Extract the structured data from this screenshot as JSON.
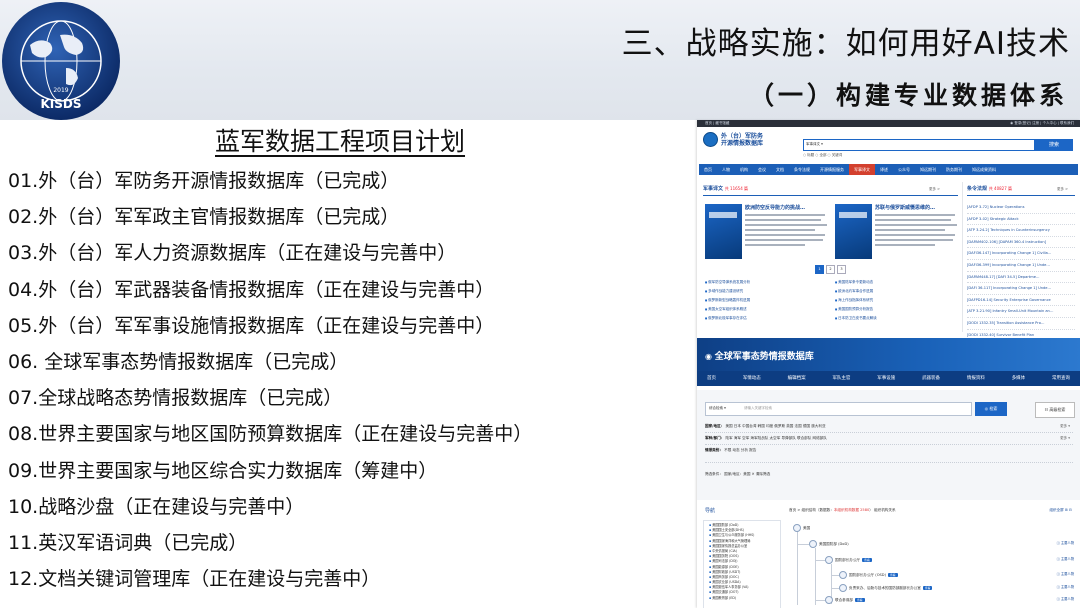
{
  "logo": {
    "text": "知远战略与防务研究所",
    "abbr": "KISDS",
    "year": "2019"
  },
  "header": {
    "title": "三、战略实施：如何用好AI技术",
    "subtitle": "（一）构建专业数据体系"
  },
  "plan": {
    "title": "蓝军数据工程项目计划",
    "items": [
      "01.外（台）军防务开源情报数据库（已完成）",
      "02.外（台）军军政主官情报数据库（已完成）",
      "03.外（台）军人力资源数据库（正在建设与完善中）",
      "04.外（台）军武器装备情报数据库（正在建设与完善中）",
      "05.外（台）军军事设施情报数据库（正在建设与完善中）",
      "06. 全球军事态势情报数据库（已完成）",
      "07.全球战略态势情报数据库（已完成）",
      "08.世界主要国家与地区国防预算数据库（正在建设与完善中）",
      "09.世界主要国家与地区综合实力数据库（筹建中）",
      "10.战略沙盘（正在建设与完善中）",
      "11.英汉军语词典（已完成）",
      "12.文档关键词管理库（正在建设与完善中）"
    ]
  },
  "site1": {
    "topbar_left": "首页  |  藏书馆藏",
    "topbar_right": "◉ 登录(登记) 注册  | 个人中心 | 联系我们",
    "brand": "外（台）军防务\n开源情报数据库",
    "search_select": "军事译文 ▾",
    "search_button": "搜索",
    "radios": "○ 标题  ○ 全部  ○ 关键词",
    "nav": [
      "首页",
      "人物",
      "机构",
      "会议",
      "文档",
      "条令法规",
      "开源情报服务",
      "军事译文",
      "译述",
      "公众号",
      "知远期刊",
      "防务期刊",
      "知远成果资料"
    ],
    "nav_active": "军事译文",
    "col1_title": "军事译文",
    "col1_count": "共 11654 篇",
    "col2_title": "条令法规",
    "col2_count": "共 40827 篇",
    "more": "更多 >",
    "card1_title": "欧洲防空反导能力的挑战…",
    "card2_title": "苏联与俄罗斯威慑思维的…",
    "pages": [
      "1",
      "2",
      "3"
    ],
    "right_list": [
      "[AFDP 3-72] Nuclear Operations",
      "[AFDP 3-02] Strategic Attack",
      "[ATP 3-24.2] Techniques in Counterinsurgency",
      "[DAPAM402-106] [DAPAM 360-4 Instruction]",
      "[DAFI36-147] Incorporating Change 1] Civilia…",
      "[DAFI36-399] Incorporating Change 1] Unde…",
      "[DAPAM448-17] [DAFI 34-5] Departme…",
      "[DAFI 36-117] Incorporating Change 1] Unde…",
      "[DAFPD16-14] Security Enterprise Governance",
      "[ATP 3-21.90] Infantry Small-Unit Mountain an…",
      "[DODI 1332.35] Transition Assistance Pro…",
      "[DODI 1332.40] Survivor Benefit Plan"
    ],
    "bottom_list_a": [
      "俄军防空导弹系统发展分析",
      "多域作战能力建设研究",
      "俄罗斯新型战略轰炸机进展",
      "美国太空军组织体系概述",
      "俄罗斯北极军事存在评估"
    ],
    "bottom_list_b": [
      "美国陆军条令更新动态",
      "欧洲北约军事合作进展",
      "海上作战指挥体系研究",
      "美国国防预算分析报告",
      "日本防卫白皮书要点解读"
    ]
  },
  "site2": {
    "title": "全球军事态势情报数据库",
    "nav": [
      "首页",
      "军情动态",
      "编辑档案",
      "军队主官",
      "军事设施",
      "武器装备",
      "情报资料",
      "多媒体",
      "常用查询"
    ],
    "search_select": "综合检索 ▾",
    "search_placeholder": "请输入关键字检索",
    "search_button": "◎ 检索",
    "adv_button": "☷ 高级检索",
    "filter1_label": "国家/地区：",
    "filter1_values": "美国   日本   中国台湾   韩国   印度   俄罗斯   英国   法国   德国   澳大利亚",
    "filter2_label": "军种/部门：",
    "filter2_values": "陆军   海军   空军   海军陆战队   太空军   导弹部队   联合部队   网络部队",
    "filter3_label": "情报类别：",
    "filter3_values": "不限   动态   分析   报告",
    "more": "更多 ▾",
    "selected_label": "筛选条件：",
    "selected_values": "国家/地区：美国   ✕ 清除筛选",
    "tree_title": "导航",
    "tree_items": [
      "美国国防部 (DoD)",
      "美国国土安全部(DHS)",
      "美国卫生与公众服务部 (HHS)",
      "美国国家海洋和大气管理局",
      "美国国家情报总监办公室",
      "中央情报局 (CIA)",
      "美国国务院 (DOS)",
      "美国司法部 (DOJ)",
      "美国能源部 (DOE)",
      "美国财政部 (USDT)",
      "美国商务部 (DOC)",
      "美国农业部 (USDA)",
      "美国退伍军人事务部 (VA)",
      "美国交通部 (DOT)",
      "美国教育部 (ED)"
    ],
    "crumb_prefix": "首页 > 组织结构（数据数：",
    "crumb_count": "本组织机构数据 2580",
    "crumb_suffix": "）  组织机构关系",
    "right_title": "组织全屏 ⊞ ⊟",
    "node_root": "美国",
    "node_dod": "美国国防部 (DoD)",
    "node_osd": "国防部长办公厅",
    "node_a": "国防部长办公厅 (OSD)",
    "node_b": "负责采办、后勤与技术的国防部副部长办公室",
    "node_c": "联合参谋部",
    "tag": "查看",
    "rlabels": [
      "主要人物",
      "主要人物",
      "主要人物",
      "主要人物",
      "主要人物"
    ]
  }
}
